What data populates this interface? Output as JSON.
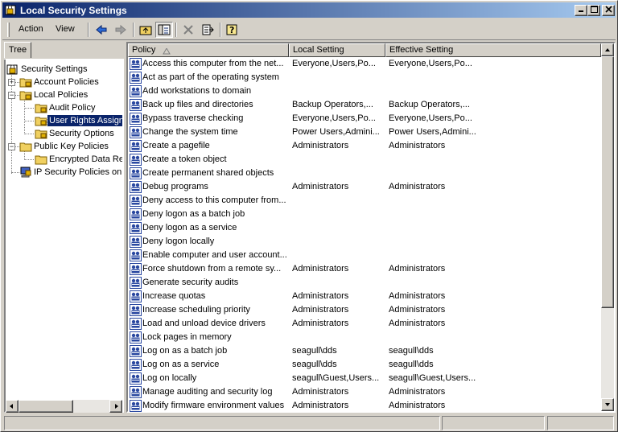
{
  "window": {
    "title": "Local Security Settings"
  },
  "menu": {
    "action": "Action",
    "view": "View"
  },
  "tree": {
    "tab_label": "Tree",
    "nodes": [
      "Security Settings",
      "Account Policies",
      "Local Policies",
      "Audit Policy",
      "User Rights Assignment",
      "Security Options",
      "Public Key Policies",
      "Encrypted Data Recovery Agents",
      "IP Security Policies on Local Machine"
    ]
  },
  "list": {
    "columns": [
      "Policy",
      "Local Setting",
      "Effective Setting"
    ],
    "rows": [
      [
        "Access this computer from the net...",
        "Everyone,Users,Po...",
        "Everyone,Users,Po..."
      ],
      [
        "Act as part of the operating system",
        "",
        ""
      ],
      [
        "Add workstations to domain",
        "",
        ""
      ],
      [
        "Back up files and directories",
        "Backup Operators,...",
        "Backup Operators,..."
      ],
      [
        "Bypass traverse checking",
        "Everyone,Users,Po...",
        "Everyone,Users,Po..."
      ],
      [
        "Change the system time",
        "Power Users,Admini...",
        "Power Users,Admini..."
      ],
      [
        "Create a pagefile",
        "Administrators",
        "Administrators"
      ],
      [
        "Create a token object",
        "",
        ""
      ],
      [
        "Create permanent shared objects",
        "",
        ""
      ],
      [
        "Debug programs",
        "Administrators",
        "Administrators"
      ],
      [
        "Deny access to this computer from...",
        "",
        ""
      ],
      [
        "Deny logon as a batch job",
        "",
        ""
      ],
      [
        "Deny logon as a service",
        "",
        ""
      ],
      [
        "Deny logon locally",
        "",
        ""
      ],
      [
        "Enable computer and user account...",
        "",
        ""
      ],
      [
        "Force shutdown from a remote sy...",
        "Administrators",
        "Administrators"
      ],
      [
        "Generate security audits",
        "",
        ""
      ],
      [
        "Increase quotas",
        "Administrators",
        "Administrators"
      ],
      [
        "Increase scheduling priority",
        "Administrators",
        "Administrators"
      ],
      [
        "Load and unload device drivers",
        "Administrators",
        "Administrators"
      ],
      [
        "Lock pages in memory",
        "",
        ""
      ],
      [
        "Log on as a batch job",
        "seagull\\dds",
        "seagull\\dds"
      ],
      [
        "Log on as a service",
        "seagull\\dds",
        "seagull\\dds"
      ],
      [
        "Log on locally",
        "seagull\\Guest,Users...",
        "seagull\\Guest,Users..."
      ],
      [
        "Manage auditing and security log",
        "Administrators",
        "Administrators"
      ],
      [
        "Modify firmware environment values",
        "Administrators",
        "Administrators"
      ]
    ]
  },
  "colors": {
    "title_start": "#0a246a",
    "title_end": "#a6caf0",
    "selection": "#0a246a",
    "face": "#d4d0c8"
  }
}
